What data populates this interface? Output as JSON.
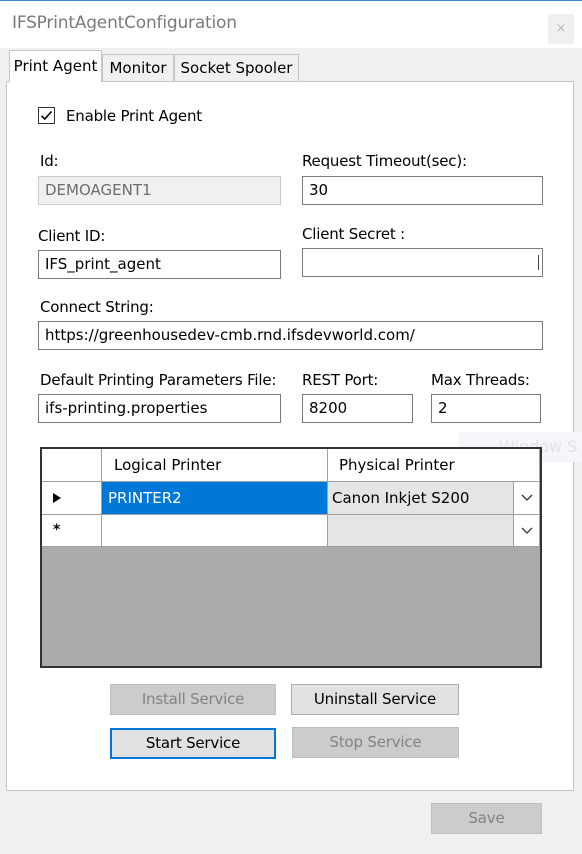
{
  "window": {
    "title": "IFSPrintAgentConfiguration",
    "close_glyph": "×"
  },
  "tabs": [
    {
      "label": "Print Agent",
      "active": true
    },
    {
      "label": "Monitor",
      "active": false
    },
    {
      "label": "Socket Spooler",
      "active": false
    }
  ],
  "enable": {
    "label": "Enable Print Agent",
    "checked": true
  },
  "fields": {
    "id": {
      "label": "Id:",
      "value": "DEMOAGENT1"
    },
    "timeout": {
      "label": "Request Timeout(sec):",
      "value": "30"
    },
    "client_id": {
      "label": "Client ID:",
      "value": "IFS_print_agent"
    },
    "client_secret": {
      "label": "Client Secret :",
      "value": ""
    },
    "connect": {
      "label": "Connect String:",
      "value": "https://greenhousedev-cmb.rnd.ifsdevworld.com/"
    },
    "params_file": {
      "label": "Default Printing Parameters File:",
      "value": "ifs-printing.properties"
    },
    "rest_port": {
      "label": "REST Port:",
      "value": "8200"
    },
    "max_threads": {
      "label": "Max Threads:",
      "value": "2"
    }
  },
  "ghost_text": "Window S",
  "grid": {
    "columns": [
      "Logical Printer",
      "Physical Printer"
    ],
    "rows": [
      {
        "logical": "PRINTER2",
        "physical": "Canon Inkjet S200",
        "indicator": "current-row-arrow-icon"
      },
      {
        "logical": "",
        "physical": "",
        "indicator": "new-row-asterisk-icon"
      }
    ]
  },
  "buttons": {
    "install": "Install Service",
    "uninstall": "Uninstall Service",
    "start": "Start Service",
    "stop": "Stop Service",
    "save": "Save"
  },
  "colors": {
    "accent": "#0078d7",
    "title_border": "#3c8ad6"
  }
}
